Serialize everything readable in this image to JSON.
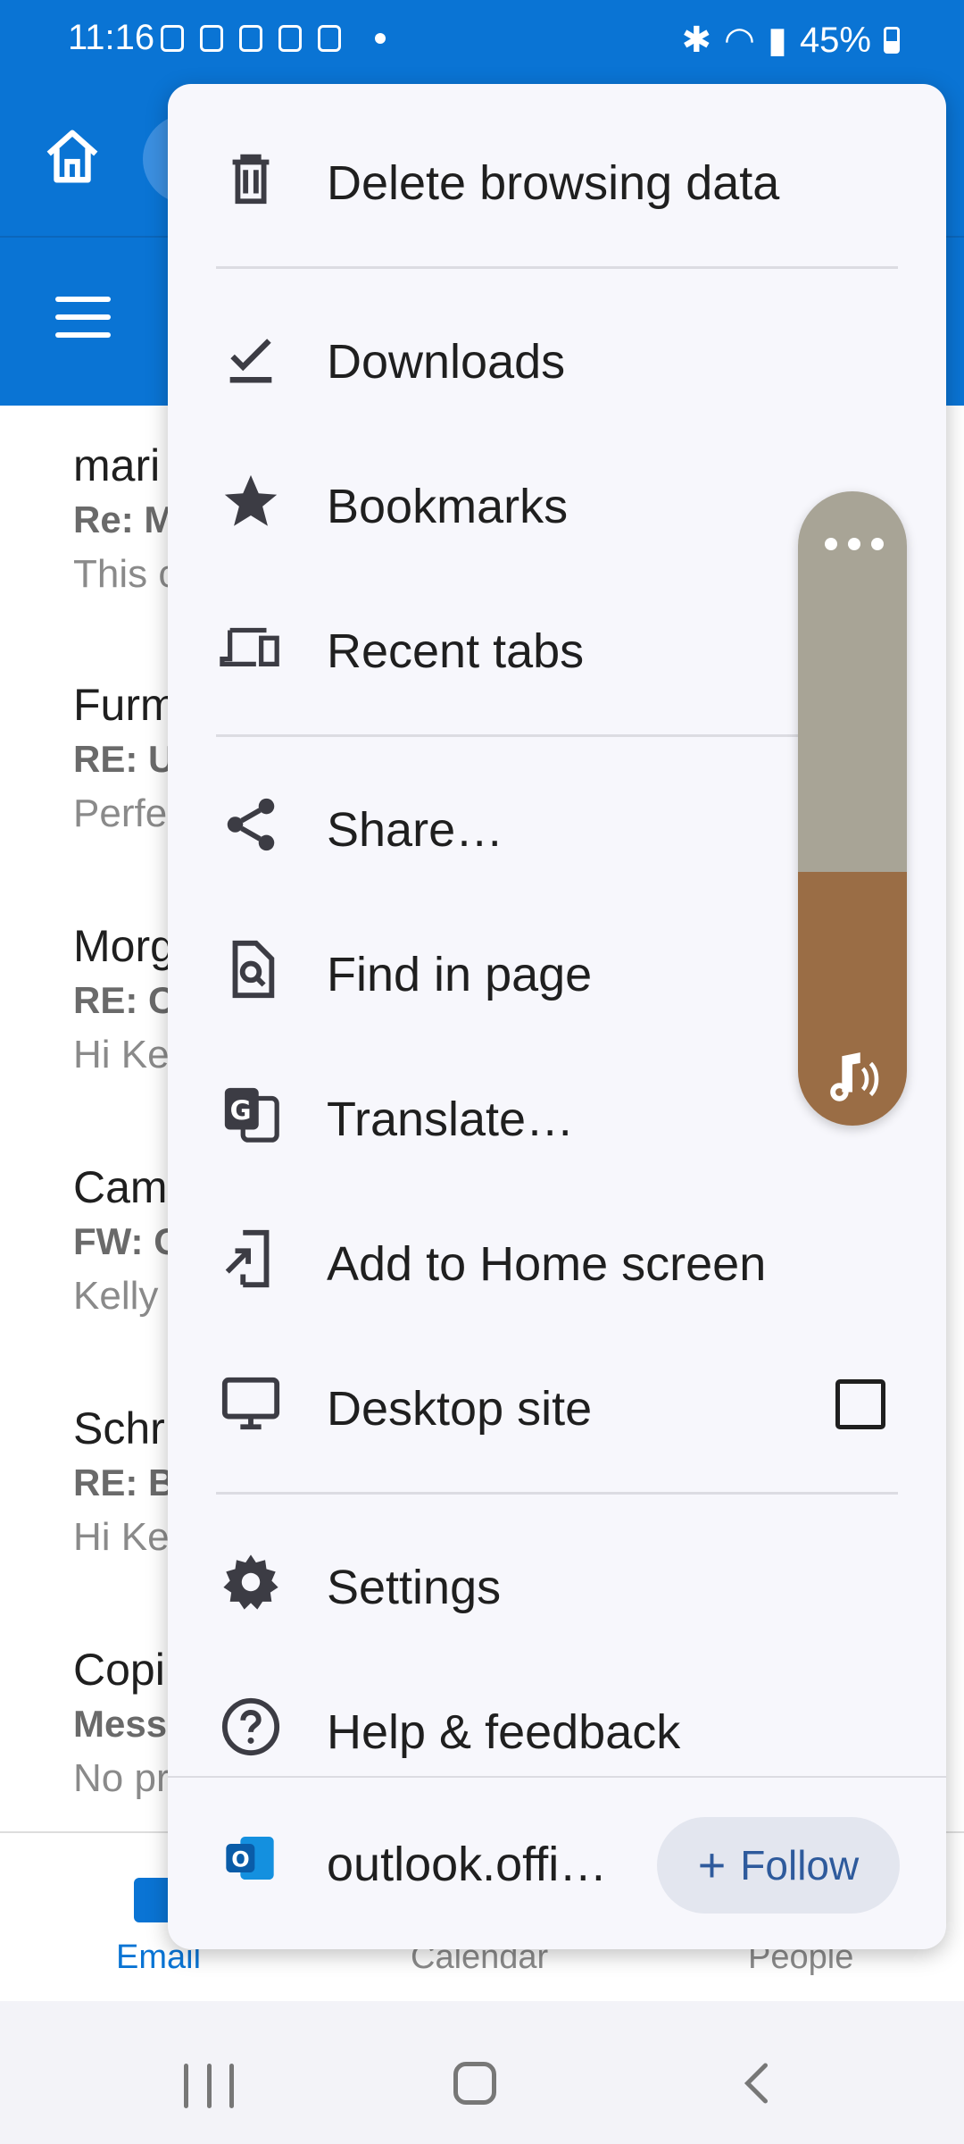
{
  "status_bar": {
    "time": "11:16",
    "battery": "45%"
  },
  "email_list": [
    {
      "sender": "mari",
      "subject": "Re: M",
      "preview": "This c"
    },
    {
      "sender": "Furm",
      "subject": "RE: U",
      "preview": "Perfe"
    },
    {
      "sender": "Morg",
      "subject": "RE: C",
      "preview": "Hi Ke"
    },
    {
      "sender": "Cam",
      "subject": "FW: C",
      "preview": "Kelly"
    },
    {
      "sender": "Schr",
      "subject": "RE: B",
      "preview": "Hi Ke"
    },
    {
      "sender": "Copi",
      "subject": "Mess",
      "preview": "No pr"
    }
  ],
  "bottom_tabs": [
    "Email",
    "Calendar",
    "People"
  ],
  "menu": {
    "items": [
      {
        "label": "Delete browsing data",
        "icon": "trash-icon"
      },
      {
        "label": "Downloads",
        "icon": "download-check-icon"
      },
      {
        "label": "Bookmarks",
        "icon": "star-icon"
      },
      {
        "label": "Recent tabs",
        "icon": "devices-icon"
      },
      {
        "label": "Share…",
        "icon": "share-icon"
      },
      {
        "label": "Find in page",
        "icon": "find-in-page-icon"
      },
      {
        "label": "Translate…",
        "icon": "translate-icon"
      },
      {
        "label": "Add to Home screen",
        "icon": "add-to-home-icon"
      },
      {
        "label": "Desktop site",
        "icon": "desktop-icon",
        "checked": false
      },
      {
        "label": "Settings",
        "icon": "gear-icon"
      },
      {
        "label": "Help & feedback",
        "icon": "help-icon"
      }
    ],
    "footer": {
      "site": "outlook.offi…",
      "follow_label": "Follow"
    }
  },
  "colors": {
    "brand_blue": "#0a74d4",
    "menu_bg": "#f7f7fc"
  }
}
